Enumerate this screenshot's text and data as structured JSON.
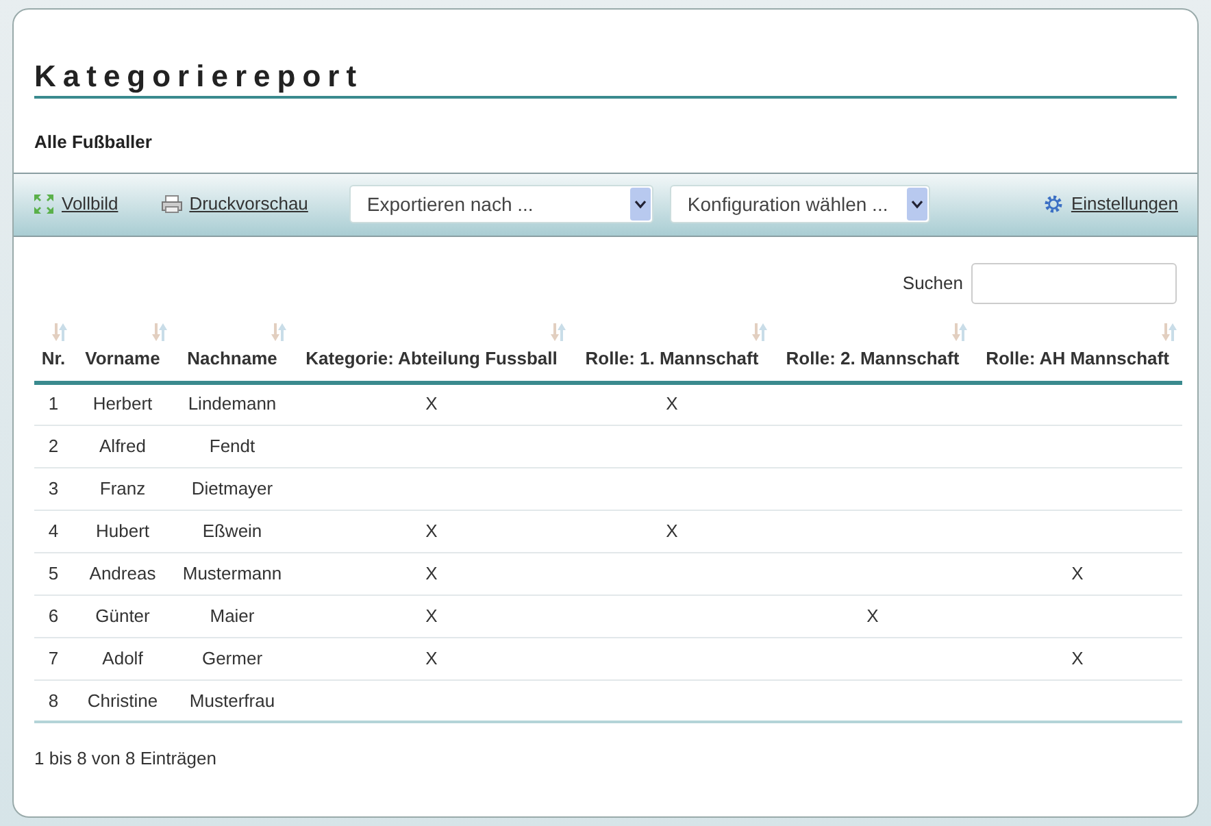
{
  "title": "Kategoriereport",
  "subtitle": "Alle Fußballer",
  "toolbar": {
    "fullscreen": "Vollbild",
    "print_preview": "Druckvorschau",
    "export_select": "Exportieren nach ...",
    "config_select": "Konfiguration wählen ...",
    "settings": "Einstellungen"
  },
  "search": {
    "label": "Suchen"
  },
  "table": {
    "columns": [
      {
        "label": "Nr."
      },
      {
        "label": "Vorname"
      },
      {
        "label": "Nachname"
      },
      {
        "label": "Kategorie: Abteilung Fussball"
      },
      {
        "label": "Rolle: 1. Mannschaft"
      },
      {
        "label": "Rolle: 2. Mannschaft"
      },
      {
        "label": "Rolle: AH Mannschaft"
      }
    ],
    "rows": [
      [
        "1",
        "Herbert",
        "Lindemann",
        "X",
        "X",
        "",
        ""
      ],
      [
        "2",
        "Alfred",
        "Fendt",
        "",
        "",
        "",
        ""
      ],
      [
        "3",
        "Franz",
        "Dietmayer",
        "",
        "",
        "",
        ""
      ],
      [
        "4",
        "Hubert",
        "Eßwein",
        "X",
        "X",
        "",
        ""
      ],
      [
        "5",
        "Andreas",
        "Mustermann",
        "X",
        "",
        "",
        "X"
      ],
      [
        "6",
        "Günter",
        "Maier",
        "X",
        "",
        "X",
        ""
      ],
      [
        "7",
        "Adolf",
        "Germer",
        "X",
        "",
        "",
        "X"
      ],
      [
        "8",
        "Christine",
        "Musterfrau",
        "",
        "",
        "",
        ""
      ]
    ]
  },
  "info": "1 bis 8 von 8 Einträgen"
}
